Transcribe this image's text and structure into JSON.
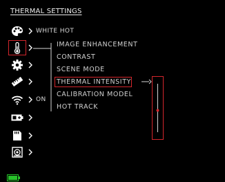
{
  "header": {
    "title": "THERMAL SETTINGS"
  },
  "colors": {
    "accent": "#d4262c",
    "battery": "#27c22a",
    "text": "#e6e6e6"
  },
  "sidebar": {
    "items": [
      {
        "icon": "palette-icon",
        "value": "WHITE HOT"
      },
      {
        "icon": "thermometer-icon",
        "value": ""
      },
      {
        "icon": "gear-icon",
        "value": ""
      },
      {
        "icon": "ruler-icon",
        "value": ""
      },
      {
        "icon": "wifi-icon",
        "value": "ON"
      },
      {
        "icon": "battery-charge-icon",
        "value": ""
      },
      {
        "icon": "sd-card-icon",
        "value": ""
      },
      {
        "icon": "video-record-icon",
        "value": ""
      }
    ]
  },
  "submenu": {
    "items": [
      "IMAGE ENHANCEMENT",
      "CONTRAST",
      "SCENE MODE",
      "THERMAL INTENSITY",
      "CALIBRATION MODEL",
      "HOT TRACK"
    ],
    "selected": "THERMAL INTENSITY"
  },
  "intensity_slider": {
    "level": 0.45
  },
  "status": {
    "battery_icon": "battery-icon"
  }
}
